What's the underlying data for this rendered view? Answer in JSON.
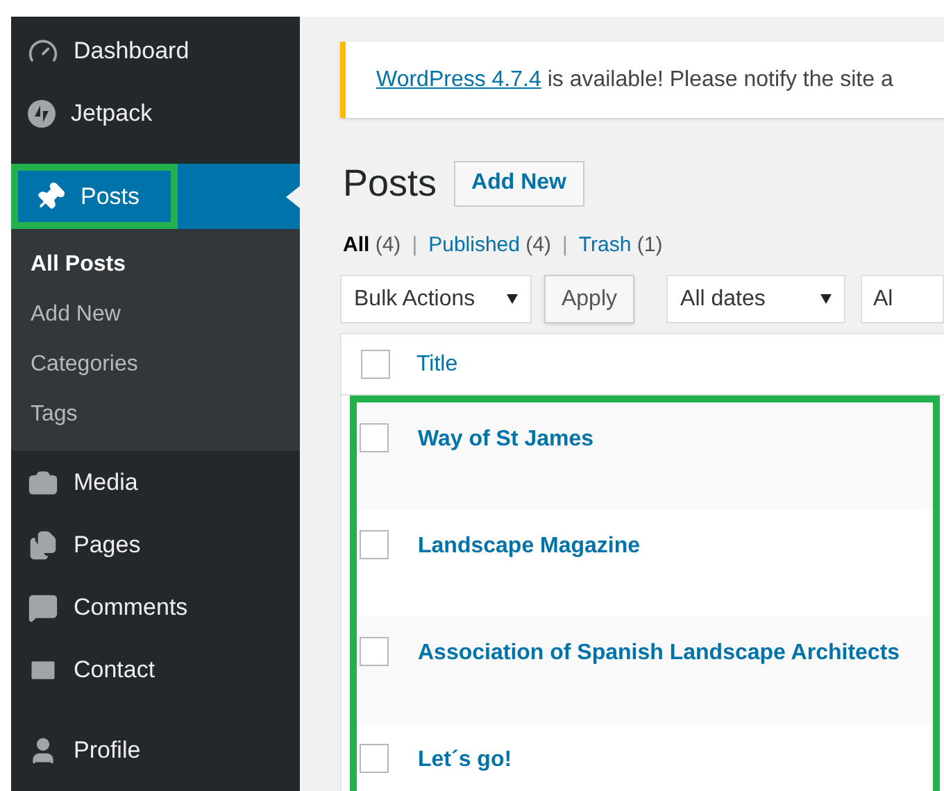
{
  "sidebar": {
    "items": [
      {
        "kind": "item",
        "label": "Dashboard",
        "selected": false,
        "highlighted": false
      },
      {
        "kind": "item",
        "label": "Jetpack",
        "selected": false,
        "highlighted": false
      },
      {
        "kind": "item",
        "label": "Posts",
        "selected": true,
        "highlighted": true,
        "children": [
          {
            "label": "All Posts",
            "selected": true
          },
          {
            "label": "Add New",
            "selected": false
          },
          {
            "label": "Categories",
            "selected": false
          },
          {
            "label": "Tags",
            "selected": false
          }
        ]
      },
      {
        "kind": "item",
        "label": "Media",
        "selected": false,
        "highlighted": false
      },
      {
        "kind": "item",
        "label": "Pages",
        "selected": false,
        "highlighted": false
      },
      {
        "kind": "item",
        "label": "Comments",
        "selected": false,
        "highlighted": false
      },
      {
        "kind": "item",
        "label": "Contact",
        "selected": false,
        "highlighted": false
      },
      {
        "kind": "separated",
        "label": "Profile",
        "selected": false,
        "highlighted": false
      }
    ]
  },
  "notice": {
    "link": "WordPress 4.7.4",
    "text": " is available! Please notify the site a"
  },
  "page": {
    "title": "Posts",
    "add_new": "Add New"
  },
  "filters": [
    {
      "label": "All",
      "count": "(4)",
      "selected": true
    },
    {
      "label": "Published",
      "count": "(4)",
      "selected": false
    },
    {
      "label": "Trash",
      "count": "(1)",
      "selected": false
    }
  ],
  "separator": "|",
  "toolbar": {
    "bulk_actions": "Bulk Actions",
    "apply": "Apply",
    "dates": "All dates",
    "category": "Al"
  },
  "table": {
    "columns": [
      "Title"
    ],
    "select_all_checked": false,
    "highlighted": true,
    "rows": [
      {
        "title": "Way of St James",
        "checked": false
      },
      {
        "title": "Landscape Magazine",
        "checked": false
      },
      {
        "title": "Association of Spanish Landscape Architects",
        "checked": false
      },
      {
        "title": "Let´s go!",
        "checked": false
      }
    ]
  }
}
